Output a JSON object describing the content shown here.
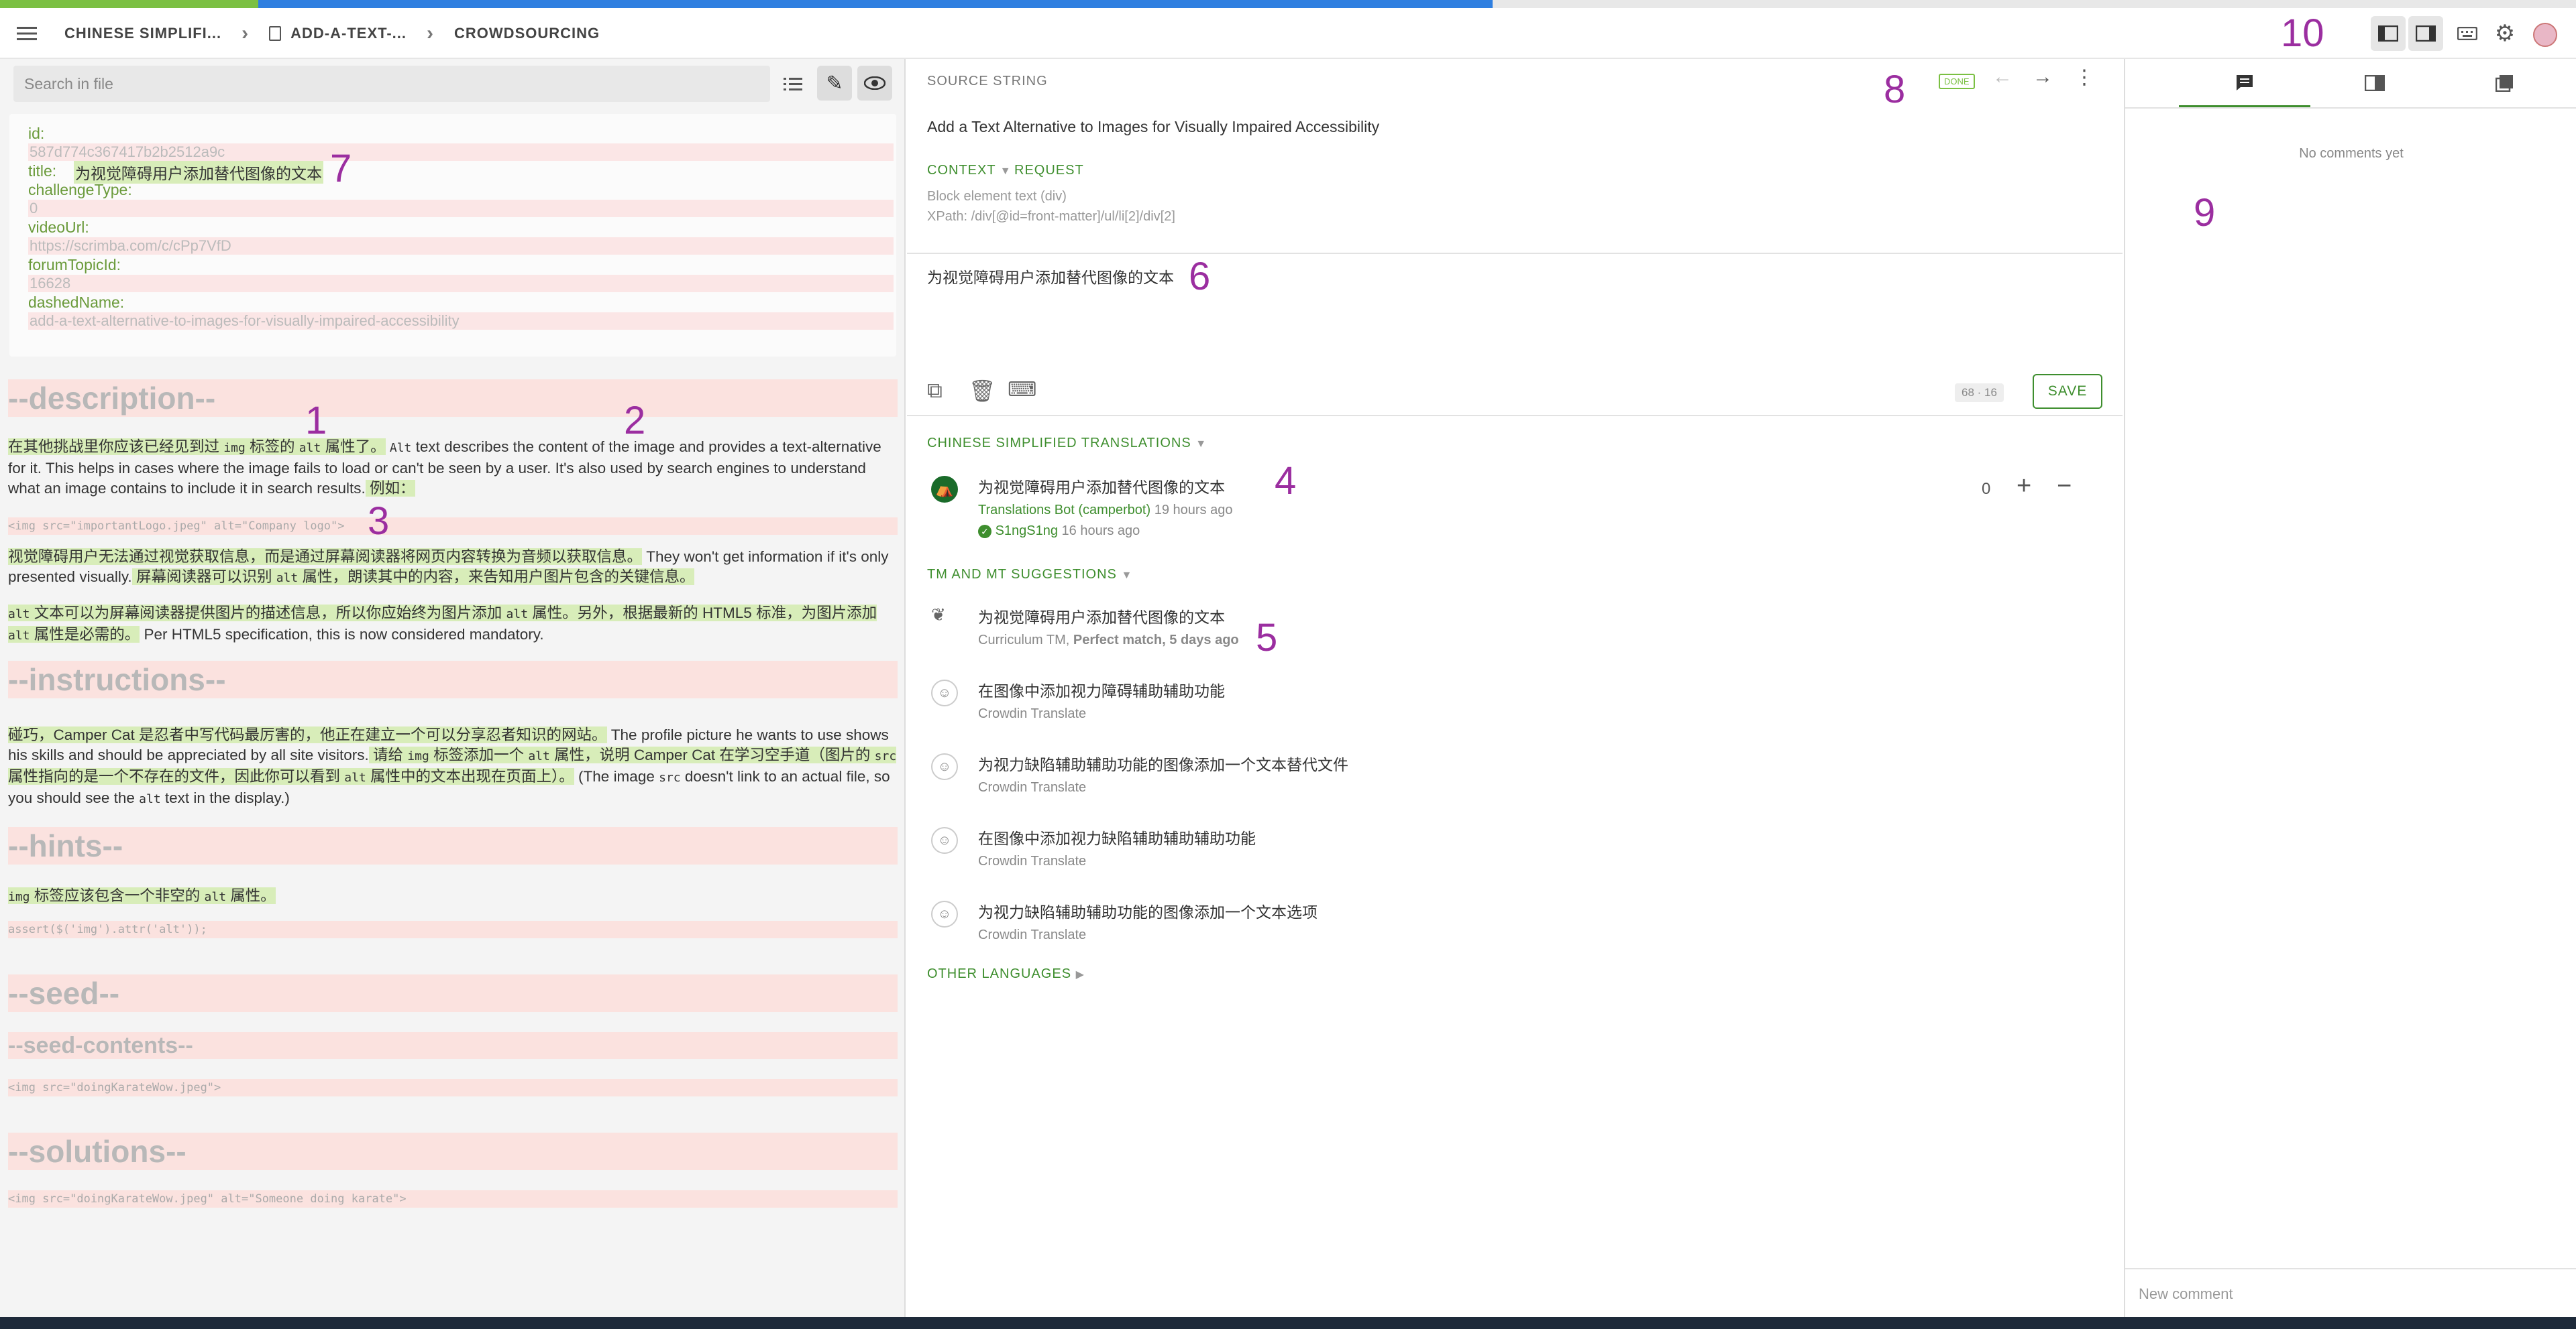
{
  "breadcrumb": {
    "project": "CHINESE SIMPLIFI...",
    "file": "ADD-A-TEXT-...",
    "branch": "CROWDSOURCING"
  },
  "left": {
    "search_placeholder": "Search in file",
    "meta": [
      {
        "key": "id:",
        "value": "587d774c367417b2b2512a9c"
      },
      {
        "key": "title:",
        "value": "为视觉障碍用户添加替代图像的文本"
      },
      {
        "key": "challengeType:",
        "value": "0"
      },
      {
        "key": "videoUrl:",
        "value": "https://scrimba.com/c/cPp7VfD"
      },
      {
        "key": "forumTopicId:",
        "value": "16628"
      },
      {
        "key": "dashedName:",
        "value": "add-a-text-alternative-to-images-for-visually-impaired-accessibility"
      }
    ],
    "description_header": "--description--",
    "desc_p1_a": "在其他挑战里你应该已经见到过 ",
    "desc_p1_code1": "img",
    "desc_p1_b": " 标签的 ",
    "desc_p1_code2": "alt",
    "desc_p1_c": " 属性了。",
    "desc_p1_code3": "Alt",
    "desc_p1_d": " text describes the content of the image and provides a text-alternative for it. This helps in cases where the image fails to load or can't be seen by a user. It's also used by search engines to understand what an image contains to include it in search results.",
    "desc_p1_e": " 例如：",
    "code1": "<img src=\"importantLogo.jpeg\" alt=\"Company logo\">",
    "desc_p2_a": "视觉障碍用户无法通过视觉获取信息，而是通过屏幕阅读器将网页内容转换为音频以获取信息。",
    "desc_p2_b": " They won't get information if it's only presented visually.",
    "desc_p2_c": " 屏幕阅读器可以识别 ",
    "desc_p2_code": "alt",
    "desc_p2_d": " 属性，朗读其中的内容，来告知用户图片包含的关键信息。",
    "desc_p3_code1": "alt",
    "desc_p3_a": " 文本可以为屏幕阅读器提供图片的描述信息，所以你应始终为图片添加 ",
    "desc_p3_code2": "alt",
    "desc_p3_b": " 属性。另外，根据最新的 HTML5 标准，为图片添加 ",
    "desc_p3_code3": "alt",
    "desc_p3_c": " 属性是必需的。",
    "desc_p3_d": " Per HTML5 specification, this is now considered mandatory.",
    "instructions_header": "--instructions--",
    "ins_a": "碰巧，Camper Cat 是忍者中写代码最厉害的，他正在建立一个可以分享忍者知识的网站。",
    "ins_b": " The profile picture he wants to use shows his skills and should be appreciated by all site visitors.",
    "ins_c": " 请给 ",
    "ins_code1": "img",
    "ins_d": " 标签添加一个 ",
    "ins_code2": "alt",
    "ins_e": " 属性，说明 Camper Cat 在学习空手道（图片的 ",
    "ins_code3": "src",
    "ins_f": " 属性指向的是一个不存在的文件，因此你可以看到 ",
    "ins_code4": "alt",
    "ins_g": " 属性中的文本出现在页面上）。",
    "ins_h": " (The image ",
    "ins_code5": "src",
    "ins_i": " doesn't link to an actual file, so you should see the ",
    "ins_code6": "alt",
    "ins_j": " text in the display.)",
    "hints_header": "--hints--",
    "hint_code1": "img",
    "hint_text": " 标签应该包含一个非空的 ",
    "hint_code2": "alt",
    "hint_text2": " 属性。",
    "code2": "assert($('img').attr('alt'));",
    "seed_header": "--seed--",
    "seed_contents_header": "--seed-contents--",
    "code3": "<img src=\"doingKarateWow.jpeg\">",
    "solutions_header": "--solutions--",
    "code4": "<img src=\"doingKarateWow.jpeg\" alt=\"Someone doing karate\">"
  },
  "center": {
    "source_label": "SOURCE STRING",
    "done_badge": "DONE",
    "source_text": "Add a Text Alternative to Images for Visually Impaired Accessibility",
    "context_label": "CONTEXT",
    "request_label": "REQUEST",
    "context_line1": "Block element text (div)",
    "context_line2": "XPath: /div[@id=front-matter]/ul/li[2]/div[2]",
    "translation_text": "为视觉障碍用户添加替代图像的文本",
    "counter": "68 · 16",
    "save_label": "SAVE",
    "translations_label": "CHINESE SIMPLIFIED TRANSLATIONS",
    "translation_item": {
      "text": "为视觉障碍用户添加替代图像的文本",
      "author": "Translations Bot (camperbot)",
      "time": " 19 hours ago",
      "approver": "S1ngS1ng",
      "approve_time": " 16 hours ago",
      "votes": "0"
    },
    "tm_label": "TM AND MT SUGGESTIONS",
    "suggestions": [
      {
        "text": "为视觉障碍用户添加替代图像的文本",
        "source": "Curriculum TM, ",
        "match": "Perfect match, 5 days ago"
      },
      {
        "text": "在图像中添加视力障碍辅助辅助功能",
        "source": "Crowdin Translate",
        "match": ""
      },
      {
        "text": "为视力缺陷辅助辅助功能的图像添加一个文本替代文件",
        "source": "Crowdin Translate",
        "match": ""
      },
      {
        "text": "在图像中添加视力缺陷辅助辅助辅助功能",
        "source": "Crowdin Translate",
        "match": ""
      },
      {
        "text": "为视力缺陷辅助辅助功能的图像添加一个文本选项",
        "source": "Crowdin Translate",
        "match": ""
      }
    ],
    "other_label": "OTHER LANGUAGES"
  },
  "right": {
    "no_comments": "No comments yet",
    "new_comment_placeholder": "New comment"
  },
  "annotations": [
    "1",
    "2",
    "3",
    "4",
    "5",
    "6",
    "7",
    "8",
    "9",
    "10"
  ],
  "colors": {
    "accent": "#3e8e2e",
    "progress_green": "#7bc043",
    "progress_blue": "#2f7fe0",
    "highlight": "#d8edb9",
    "pink": "#fbe2df",
    "annotation": "#9b2ea0"
  }
}
